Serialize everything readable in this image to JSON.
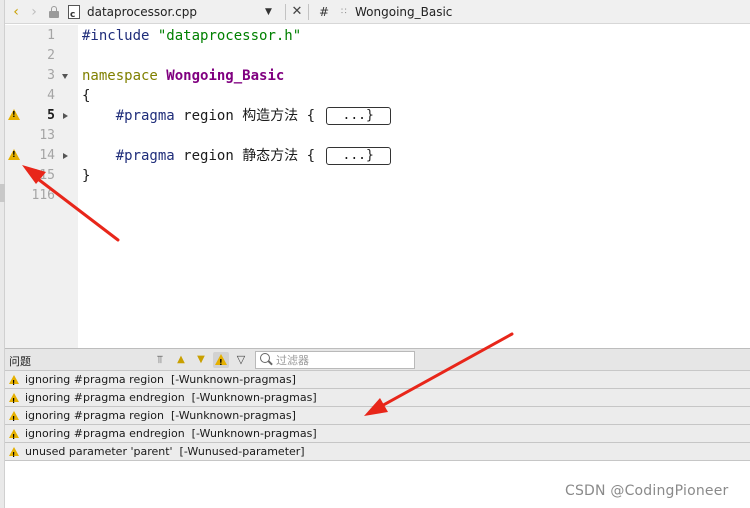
{
  "tabbar": {
    "filename": "dataprocessor.cpp",
    "hash": "#",
    "namespace": "Wongoing_Basic"
  },
  "editor": {
    "lines": [
      {
        "num": "1",
        "text": "#include \"dataprocessor.h\""
      },
      {
        "num": "2",
        "text": ""
      },
      {
        "num": "3",
        "text": "namespace Wongoing_Basic"
      },
      {
        "num": "4",
        "text": "{"
      },
      {
        "num": "5",
        "text": "#pragma region 构造方法 {",
        "collapsed": "...}",
        "warning": true
      },
      {
        "num": "13",
        "text": ""
      },
      {
        "num": "14",
        "text": "#pragma region 静态方法 {",
        "collapsed": "...}",
        "warning": true
      },
      {
        "num": "115",
        "text": "}"
      },
      {
        "num": "116",
        "text": ""
      }
    ],
    "include_directive": "#include",
    "include_file": "\"dataprocessor.h\"",
    "namespace_kw": "namespace",
    "namespace_name": "Wongoing_Basic",
    "pragma": "#pragma",
    "region_kw": "region",
    "region1_name": "构造方法",
    "region2_name": "静态方法",
    "open_brace": "{",
    "close_brace": "}",
    "collapsed_text": "...}",
    "line_116": "116"
  },
  "issues_pane": {
    "title": "问题",
    "filter_placeholder": "过滤器",
    "items": [
      "ignoring #pragma region  [-Wunknown-pragmas]",
      "ignoring #pragma endregion  [-Wunknown-pragmas]",
      "ignoring #pragma region  [-Wunknown-pragmas]",
      "ignoring #pragma endregion  [-Wunknown-pragmas]",
      "unused parameter 'parent'  [-Wunused-parameter]"
    ]
  },
  "watermark": "CSDN @CodingPioneer",
  "colors": {
    "warning": "#e5b000",
    "annotation_arrow": "#e8261a",
    "string": "#008000",
    "namespace_name": "#800080",
    "keyword": "#808000"
  }
}
